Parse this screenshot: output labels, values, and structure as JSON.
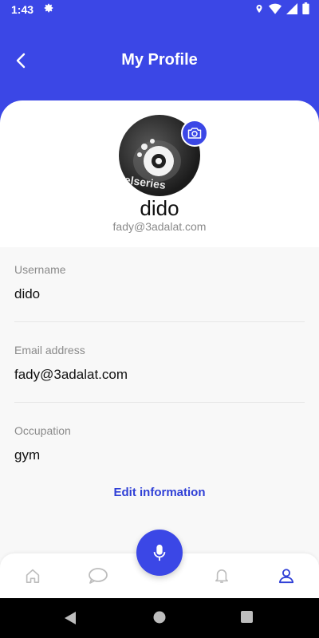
{
  "status_bar": {
    "time": "1:43"
  },
  "header": {
    "title": "My Profile"
  },
  "profile": {
    "name": "dido",
    "email": "fady@3adalat.com",
    "avatar_text": "elseries"
  },
  "fields": [
    {
      "label": "Username",
      "value": "dido"
    },
    {
      "label": "Email address",
      "value": "fady@3adalat.com"
    },
    {
      "label": "Occupation",
      "value": "gym"
    }
  ],
  "edit_label": "Edit information",
  "bottom_nav": {
    "items": [
      "home-icon",
      "chat-icon",
      "mic-icon",
      "bell-icon",
      "person-icon"
    ],
    "active": "person-icon"
  },
  "colors": {
    "accent": "#3b47e6",
    "link": "#2f3fd6",
    "muted": "#8a8a8a"
  }
}
